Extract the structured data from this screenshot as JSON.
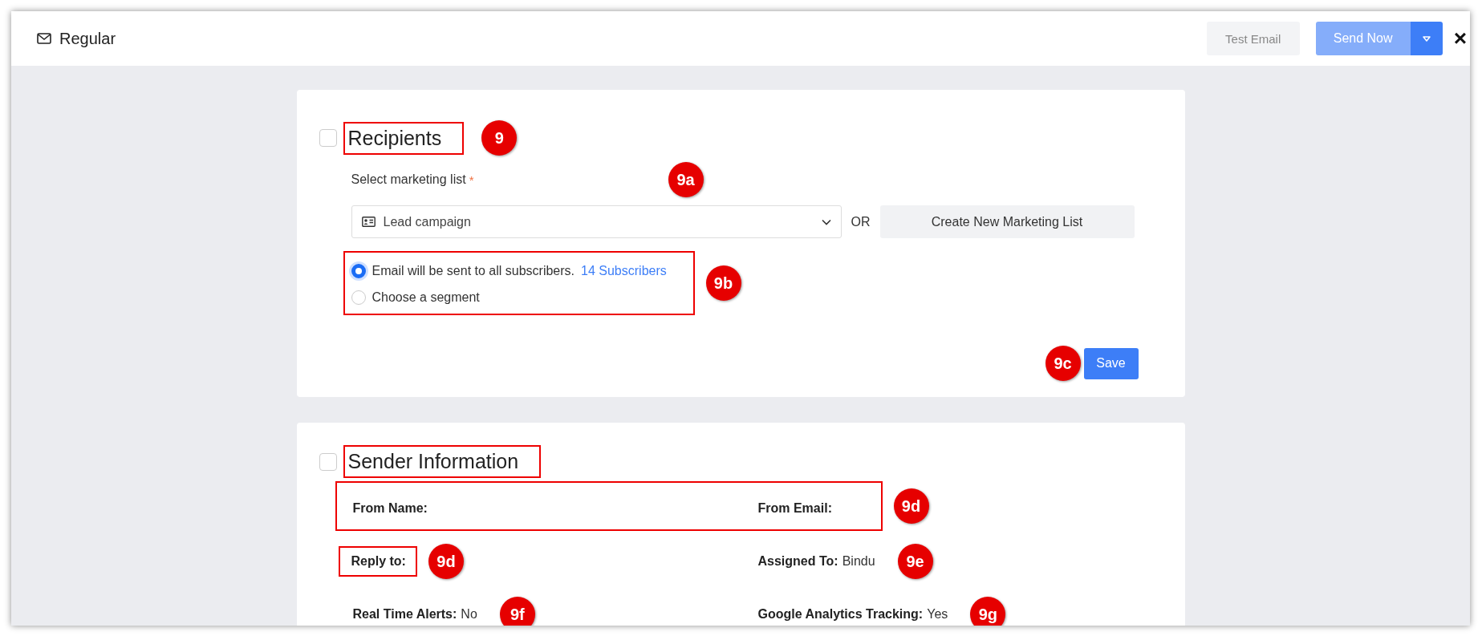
{
  "header": {
    "title": "Regular",
    "test_email_button": {
      "label": "Test Email",
      "disabled": true
    },
    "send_button": {
      "label": "Send Now",
      "disabled": true
    },
    "close": "×"
  },
  "recipients": {
    "title": "Recipients",
    "checked": false,
    "highlighted": true,
    "callout": "9",
    "list_label": "Select marketing list",
    "required_mark": "*",
    "list_callout": "9a",
    "selected_list": "Lead campaign",
    "or_text": "OR",
    "create_button": "Create New Marketing List",
    "options": [
      {
        "label": "Email will be sent to all subscribers.",
        "link": "14 Subscribers",
        "selected": true
      },
      {
        "label": "Choose a segment",
        "selected": false
      }
    ],
    "options_highlighted": true,
    "options_callout": "9b",
    "save_button": "Save",
    "save_callout": "9c"
  },
  "sender": {
    "title": "Sender Information",
    "checked": false,
    "highlighted": true,
    "rows": [
      {
        "highlighted": true,
        "callout": "9d",
        "fields": [
          {
            "label": "From Name:"
          },
          {
            "label": "From Email:"
          }
        ]
      },
      {
        "fields": [
          {
            "label": "Reply to:",
            "highlighted": true,
            "callout": "9d"
          },
          {
            "label": "Assigned To:",
            "value": "Bindu",
            "callout": "9e"
          }
        ]
      },
      {
        "fields": [
          {
            "label": "Real Time Alerts:",
            "value": "No",
            "callout": "9f"
          },
          {
            "label": "Google Analytics Tracking:",
            "value": "Yes",
            "callout": "9g"
          }
        ]
      }
    ]
  }
}
